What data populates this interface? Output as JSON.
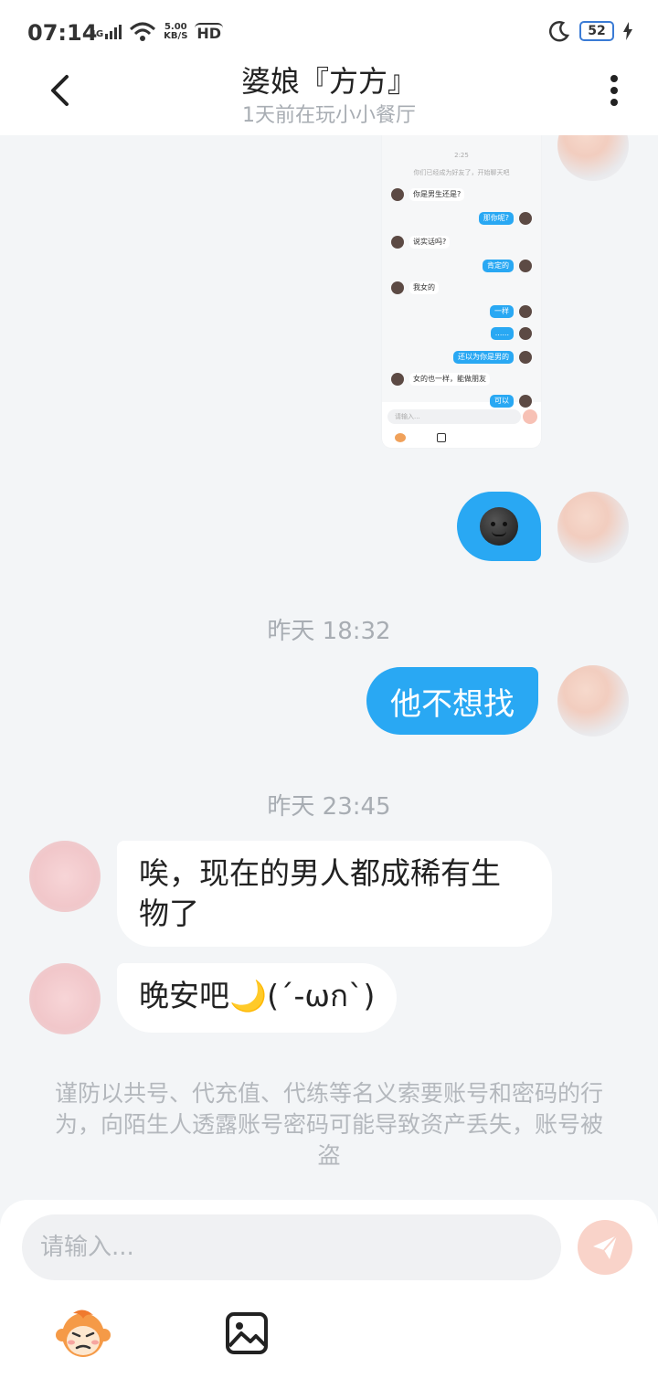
{
  "status_bar": {
    "time": "07:14",
    "network": "4G",
    "speed_value": "5.00",
    "speed_unit": "KB/S",
    "hd": "HD",
    "battery": "52"
  },
  "header": {
    "title": "婆娘『方方』",
    "subtitle": "1天前在玩小小餐厅"
  },
  "screenshot_preview": {
    "timestamp": "2:25",
    "notice": "你们已经成为好友了，开始聊天吧",
    "messages": [
      {
        "side": "in",
        "text": "你是男生还是?"
      },
      {
        "side": "out",
        "text": "那你呢?"
      },
      {
        "side": "in",
        "text": "说实话吗?"
      },
      {
        "side": "out",
        "text": "肯定的"
      },
      {
        "side": "in",
        "text": "我女的"
      },
      {
        "side": "out",
        "text": "一样"
      },
      {
        "side": "out",
        "text": "......"
      },
      {
        "side": "out",
        "text": "还以为你是男的"
      },
      {
        "side": "in",
        "text": "女的也一样，能做朋友"
      },
      {
        "side": "out",
        "text": "可以"
      }
    ],
    "input_placeholder": "请输入..."
  },
  "messages": {
    "ts1": "昨天 18:32",
    "out1": "他不想找",
    "ts2": "昨天 23:45",
    "in1": "唉，现在的男人都成稀有生物了",
    "in2": "晚安吧🌙(´-ωก`)"
  },
  "notice": "谨防以共号、代充值、代练等名义索要账号和密码的行为，向陌生人透露账号密码可能导致资产丢失，账号被盗",
  "input": {
    "placeholder": "请输入..."
  },
  "colors": {
    "accent": "#29a8f3",
    "send_disabled": "#f9d3c9",
    "background": "#f3f5f7"
  }
}
